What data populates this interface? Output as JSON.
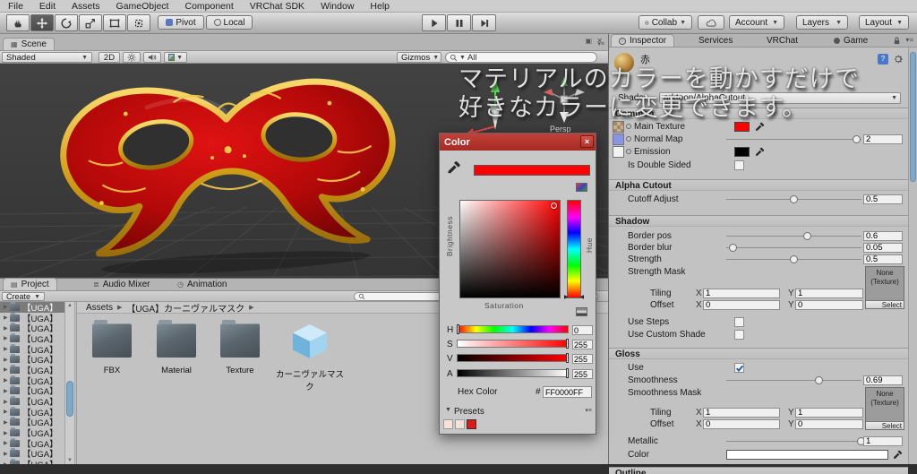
{
  "colors": {
    "accent_scrollbar": "#7fa8c8",
    "current_color": "#ff0000",
    "color_window_title": "#b5332c",
    "scene_background": "#3d3d3d",
    "panel_background": "#c2c2c2",
    "folder_icon": "#5b666e",
    "prefab_cube": "#8ecdee",
    "checkbox_check": "#2b5fa5"
  },
  "menu": {
    "items": [
      "File",
      "Edit",
      "Assets",
      "GameObject",
      "Component",
      "VRChat SDK",
      "Window",
      "Help"
    ]
  },
  "toolbar": {
    "pivot_label": "Pivot",
    "local_label": "Local",
    "collab_label": "Collab",
    "account_label": "Account",
    "layers_label": "Layers",
    "layout_label": "Layout"
  },
  "scene": {
    "tab_label": "Scene",
    "shading_mode": "Shaded",
    "mode_2d": "2D",
    "gizmos_label": "Gizmos",
    "search_value": "All",
    "persp_label": "Persp"
  },
  "overlay": {
    "line1": "マテリアルのカラーを動かすだけで",
    "line2": "好きなカラーに変更できます。"
  },
  "color_window": {
    "title": "Color",
    "close": "×",
    "brightness_label": "Brightness",
    "saturation_label": "Saturation",
    "hue_label": "Hue",
    "sliders": [
      {
        "label": "H",
        "value": "0"
      },
      {
        "label": "S",
        "value": "255"
      },
      {
        "label": "V",
        "value": "255"
      },
      {
        "label": "A",
        "value": "255"
      }
    ],
    "hex_label": "Hex Color",
    "hex_prefix": "#",
    "hex_value": "FF0000FF",
    "presets_label": "Presets"
  },
  "inspector": {
    "tabs": {
      "inspector": "Inspector",
      "services": "Services",
      "vrchat": "VRChat",
      "game": "Game"
    },
    "material_name": "赤",
    "shader_label": "Shader",
    "shader_value": "arktoon/AlphaCutout",
    "sections": {
      "common": "Common",
      "alpha_cutout": "Alpha Cutout",
      "shadow": "Shadow",
      "gloss": "Gloss",
      "outline": "Outline"
    },
    "common": {
      "main_texture_label": "Main Texture",
      "normal_map_label": "Normal Map",
      "normal_map_value": "2",
      "emission_label": "Emission",
      "is_double_sided_label": "Is Double Sided"
    },
    "alpha_cutout": {
      "cutoff_label": "Cutoff Adjust",
      "cutoff_value": "0.5"
    },
    "shadow": {
      "border_pos_label": "Border pos",
      "border_pos_value": "0.6",
      "border_blur_label": "Border blur",
      "border_blur_value": "0.05",
      "strength_label": "Strength",
      "strength_value": "0.5",
      "strength_mask_label": "Strength Mask",
      "none_texture": "None (Texture)",
      "select_label": "Select",
      "tiling_label": "Tiling",
      "offset_label": "Offset",
      "x_label": "X",
      "y_label": "Y",
      "tiling_x": "1",
      "tiling_y": "1",
      "offset_x": "0",
      "offset_y": "0",
      "use_steps_label": "Use Steps",
      "use_custom_shade_label": "Use Custom Shade"
    },
    "gloss": {
      "use_label": "Use",
      "smoothness_label": "Smoothness",
      "smoothness_value": "0.69",
      "smoothness_mask_label": "Smoothness Mask",
      "none_texture": "None (Texture)",
      "select_label": "Select",
      "tiling_label": "Tiling",
      "offset_label": "Offset",
      "x_label": "X",
      "y_label": "Y",
      "tiling_x": "1",
      "tiling_y": "1",
      "offset_x": "0",
      "offset_y": "0",
      "metallic_label": "Metallic",
      "metallic_value": "1",
      "color_label": "Color"
    }
  },
  "project": {
    "tabs": {
      "project": "Project",
      "audio_mixer": "Audio Mixer",
      "animation": "Animation"
    },
    "create_label": "Create",
    "breadcrumb": {
      "root": "Assets",
      "folder": "【UGA】カーニヴァルマスク"
    },
    "tree_label": "【UGA】",
    "tree_count": 16,
    "items": {
      "fbx": "FBX",
      "material": "Material",
      "texture": "Texture",
      "prefab": "カーニヴァルマスク"
    }
  }
}
